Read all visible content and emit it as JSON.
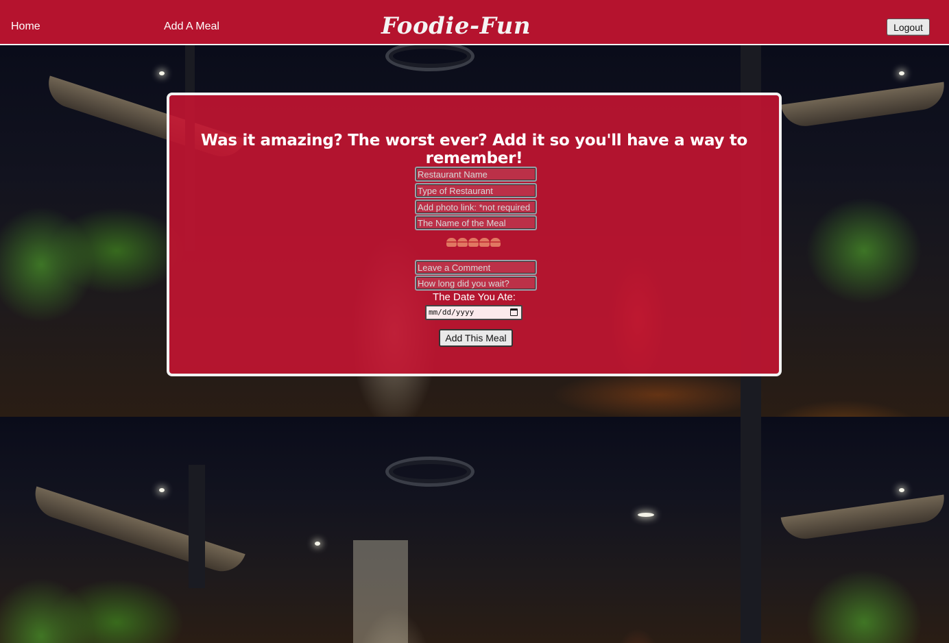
{
  "nav": {
    "home_label": "Home",
    "add_meal_label": "Add A Meal",
    "brand": "Foodie-Fun",
    "logout_label": "Logout"
  },
  "form": {
    "title": "Was it amazing? The worst ever? Add it so you'll have a way to remember!",
    "restaurant_name_placeholder": "Restaurant Name",
    "restaurant_type_placeholder": "Type of Restaurant",
    "photo_link_placeholder": "Add photo link: *not required",
    "meal_name_placeholder": "The Name of the Meal",
    "rating_icon": "burger-icon",
    "rating_max": 5,
    "comment_placeholder": "Leave a Comment",
    "wait_time_placeholder": "How long did you wait?",
    "date_label": "The Date You Ate:",
    "date_placeholder": "mm/dd/yyyy",
    "submit_label": "Add This Meal"
  },
  "colors": {
    "navbar": "#b5132e",
    "card": "#c81432",
    "card_border": "#f2f2f2"
  }
}
